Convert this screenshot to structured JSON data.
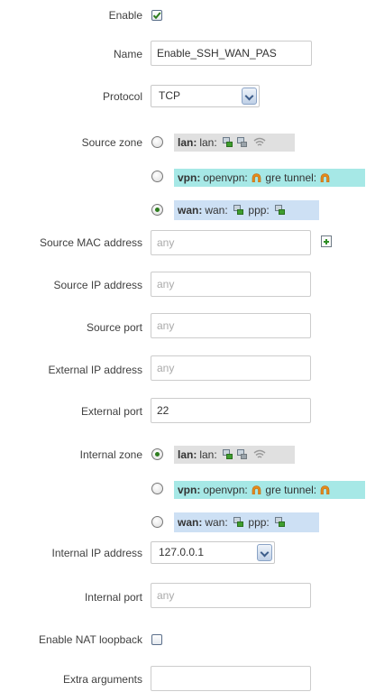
{
  "enable": {
    "label": "Enable",
    "checked": true
  },
  "name": {
    "label": "Name",
    "value": "Enable_SSH_WAN_PAS"
  },
  "protocol": {
    "label": "Protocol",
    "value": "TCP"
  },
  "source_zone": {
    "label": "Source zone",
    "options": [
      {
        "zone": "lan:",
        "text": "lan:",
        "selected": false
      },
      {
        "zone": "vpn:",
        "text": "openvpn:",
        "text2": "gre tunnel:",
        "selected": false
      },
      {
        "zone": "wan:",
        "text": "wan:",
        "text2": "ppp:",
        "selected": true
      }
    ]
  },
  "source_mac": {
    "label": "Source MAC address",
    "placeholder": "any"
  },
  "source_ip": {
    "label": "Source IP address",
    "placeholder": "any"
  },
  "source_port": {
    "label": "Source port",
    "placeholder": "any"
  },
  "external_ip": {
    "label": "External IP address",
    "placeholder": "any"
  },
  "external_port": {
    "label": "External port",
    "value": "22"
  },
  "internal_zone": {
    "label": "Internal zone",
    "options": [
      {
        "zone": "lan:",
        "text": "lan:",
        "selected": true
      },
      {
        "zone": "vpn:",
        "text": "openvpn:",
        "text2": "gre tunnel:",
        "selected": false
      },
      {
        "zone": "wan:",
        "text": "wan:",
        "text2": "ppp:",
        "selected": false
      }
    ]
  },
  "internal_ip": {
    "label": "Internal IP address",
    "value": "127.0.0.1"
  },
  "internal_port": {
    "label": "Internal port",
    "placeholder": "any"
  },
  "nat_loopback": {
    "label": "Enable NAT loopback",
    "checked": false
  },
  "extra_arguments": {
    "label": "Extra arguments",
    "value": ""
  },
  "icons": {
    "network": "network-icon",
    "wifi": "wifi-icon",
    "tunnel": "tunnel-icon",
    "add": "add-icon",
    "accent_green": "#2e7d1f"
  }
}
